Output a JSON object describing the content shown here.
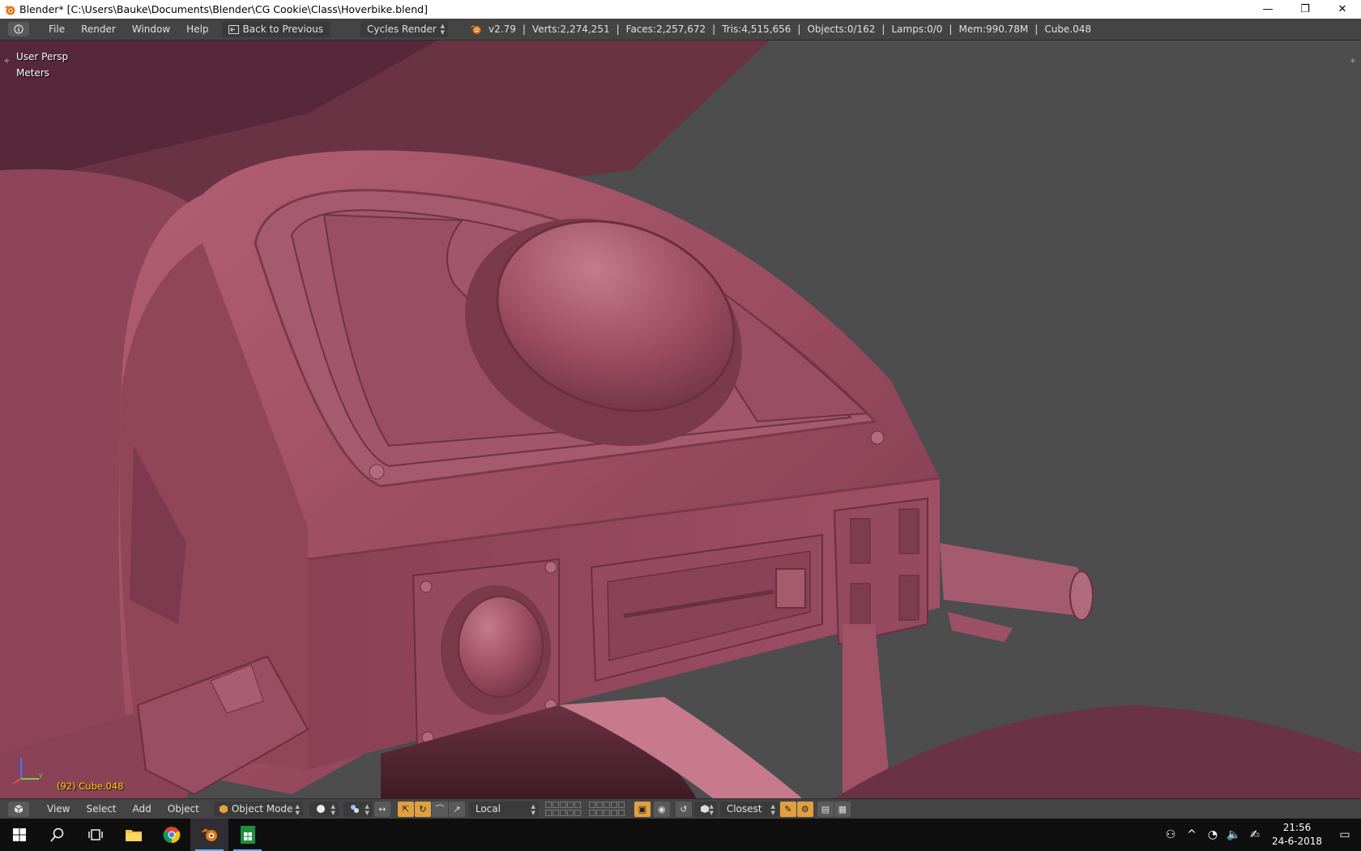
{
  "window": {
    "title": "Blender* [C:\\Users\\Bauke\\Documents\\Blender\\CG Cookie\\Class\\Hoverbike.blend]",
    "minimize": "—",
    "restore": "❐",
    "close": "✕"
  },
  "info_header": {
    "menus": [
      "File",
      "Render",
      "Window",
      "Help"
    ],
    "back_button": "Back to Previous",
    "render_engine": "Cycles Render",
    "stats": {
      "version": "v2.79",
      "verts": "Verts:2,274,251",
      "faces": "Faces:2,257,672",
      "tris": "Tris:4,515,656",
      "objects": "Objects:0/162",
      "lamps": "Lamps:0/0",
      "mem": "Mem:990.78M",
      "active": "Cube.048"
    },
    "separator": "|"
  },
  "viewport": {
    "view_name": "User Persp",
    "units": "Meters",
    "active_object_label": "(92) Cube.048",
    "colors": {
      "background": "#4d4d4d",
      "matcap_light": "#a65469",
      "matcap_mid": "#8a4257",
      "matcap_dark": "#5c2a38"
    },
    "axis_labels": {
      "x": "x",
      "y": "y",
      "z": "z"
    }
  },
  "view3d_header": {
    "menus": [
      "View",
      "Select",
      "Add",
      "Object"
    ],
    "mode": "Object Mode",
    "pivot_orientation": "Local",
    "snap_target": "Closest"
  },
  "taskbar": {
    "apps": [
      "start-icon",
      "search-icon",
      "task-view-icon",
      "file-explorer-icon",
      "chrome-icon",
      "blender-icon",
      "spreadsheet-icon"
    ],
    "time": "21:56",
    "date": "24-6-2018"
  }
}
